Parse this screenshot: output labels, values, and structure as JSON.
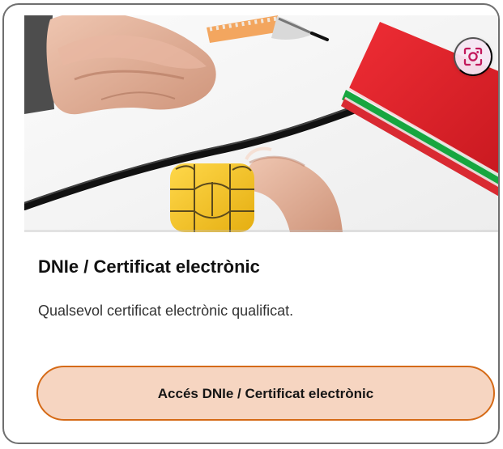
{
  "card": {
    "title": "DNIe / Certificat electrònic",
    "description": "Qualsevol certificat electrònic qualificat.",
    "button_label": "Accés DNIe / Certificat electrònic"
  },
  "hero": {
    "image_subject": "hand-writing-with-pen-and-electronic-certificate-chip",
    "visual_search_icon": "camera-lens-icon"
  },
  "colors": {
    "card_border": "#6f6f6f",
    "button_border": "#d56a16",
    "button_fill": "#f6d5c1",
    "chip_gold": "#f0c22a",
    "folder_red": "#e22b32",
    "folder_green": "#24a843",
    "lens_icon": "#c2185b"
  }
}
